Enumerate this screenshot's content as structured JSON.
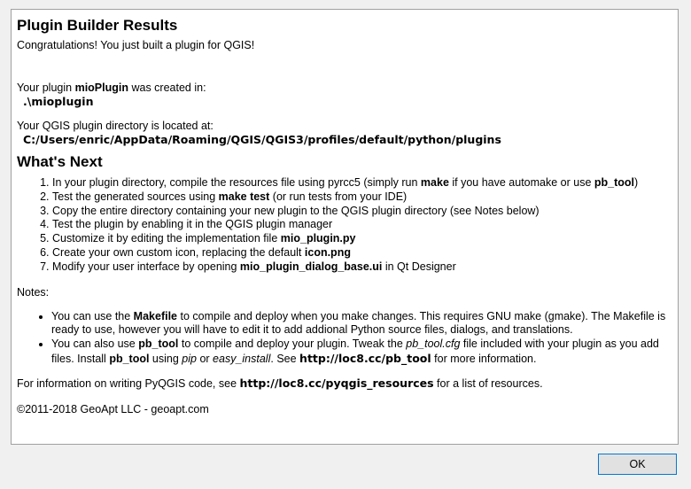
{
  "title": "Plugin Builder Results",
  "congrats": "Congratulations! You just built a plugin for QGIS!",
  "created": {
    "prefix": "Your plugin ",
    "plugin_name": "mioPlugin",
    "suffix": " was created in:",
    "path": ".\\mioplugin"
  },
  "plugin_dir": {
    "label": "Your QGIS plugin directory is located at:",
    "path": "C:/Users/enric/AppData/Roaming/QGIS/QGIS3/profiles/default/python/plugins"
  },
  "whats_next": {
    "heading": "What's Next",
    "step1": {
      "a": "In your plugin directory, compile the resources file using pyrcc5 (simply run ",
      "b1": "make",
      "c": " if you have automake or use ",
      "b2": "pb_tool",
      "d": ")"
    },
    "step2": {
      "a": "Test the generated sources using ",
      "b": "make test",
      "c": " (or run tests from your IDE)"
    },
    "step3": "Copy the entire directory containing your new plugin to the QGIS plugin directory (see Notes below)",
    "step4": "Test the plugin by enabling it in the QGIS plugin manager",
    "step5": {
      "a": "Customize it by editing the implementation file ",
      "b": "mio_plugin.py"
    },
    "step6": {
      "a": "Create your own custom icon, replacing the default ",
      "b": "icon.png"
    },
    "step7": {
      "a": "Modify your user interface by opening ",
      "b": "mio_plugin_dialog_base.ui",
      "c": " in Qt Designer"
    }
  },
  "notes": {
    "label": "Notes:",
    "note1": {
      "a": "You can use the ",
      "b": "Makefile",
      "c": " to compile and deploy when you make changes. This requires GNU make (gmake). The Makefile is ready to use, however you will have to edit it to add addional Python source files, dialogs, and translations."
    },
    "note2": {
      "a": "You can also use ",
      "b1": "pb_tool",
      "c": " to compile and deploy your plugin. Tweak the ",
      "i1": "pb_tool.cfg",
      "d": " file included with your plugin as you add files. Install ",
      "b2": "pb_tool",
      "e": " using ",
      "i2": "pip",
      "f": " or ",
      "i3": "easy_install",
      "g": ". See ",
      "link": "http://loc8.cc/pb_tool",
      "h": " for more information."
    }
  },
  "info": {
    "a": "For information on writing PyQGIS code, see ",
    "link": "http://loc8.cc/pyqgis_resources",
    "b": " for a list of resources."
  },
  "copyright": "©2011-2018 GeoApt LLC - geoapt.com",
  "ok_button": "OK"
}
